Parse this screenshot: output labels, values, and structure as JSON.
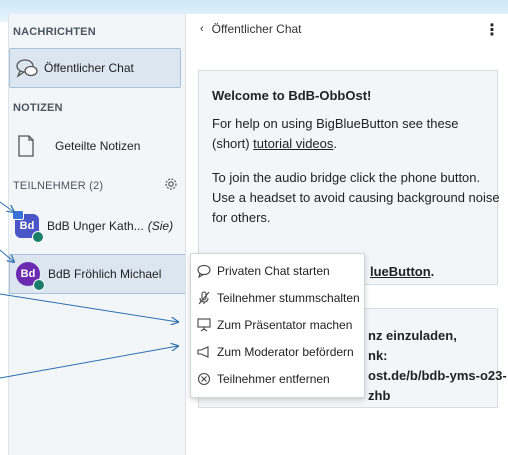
{
  "sidebar": {
    "messages_title": "NACHRICHTEN",
    "public_chat_label": "Öffentlicher Chat",
    "notes_title": "NOTIZEN",
    "shared_notes_label": "Geteilte Notizen",
    "participants_title": "TEILNEHMER (2)",
    "users": [
      {
        "initials": "Bd",
        "name": "BdB Unger Kath...",
        "suffix": "(Sie)",
        "color": "#4a55c8"
      },
      {
        "initials": "Bd",
        "name": "BdB Fröhlich Michael",
        "suffix": "",
        "color": "#6a2bb0"
      }
    ]
  },
  "chat": {
    "header_title": "Öffentlicher Chat",
    "welcome": {
      "line1": "Welcome to BdB-ObbOst!",
      "line2": "For help on using BigBlueButton see these",
      "line3_prefix": "(short) ",
      "line3_link": "tutorial videos",
      "line3_suffix": ".",
      "line4": "To join the audio bridge click the phone button.",
      "line5": "Use a headset to avoid causing background noise",
      "line6": "for others.",
      "line7_link": "lueButton",
      "line7_suffix": "."
    },
    "invite": {
      "line1": "nz einzuladen,",
      "line2": "nk:",
      "line3": "ost.de/b/bdb-yms-o23-",
      "line4": "zhb"
    }
  },
  "context_menu": {
    "items": [
      {
        "label": "Privaten Chat starten",
        "icon": "chat-bubble-icon"
      },
      {
        "label": "Teilnehmer stummschalten",
        "icon": "mic-off-icon"
      },
      {
        "label": "Zum Präsentator machen",
        "icon": "presentation-icon"
      },
      {
        "label": "Zum Moderator befördern",
        "icon": "megaphone-icon"
      },
      {
        "label": "Teilnehmer entfernen",
        "icon": "remove-circle-icon"
      }
    ]
  },
  "colors": {
    "annotation_arrow": "#2a6fb0",
    "avatar_badge": "#1a7f6a",
    "selection_bg": "#dce6f0"
  }
}
